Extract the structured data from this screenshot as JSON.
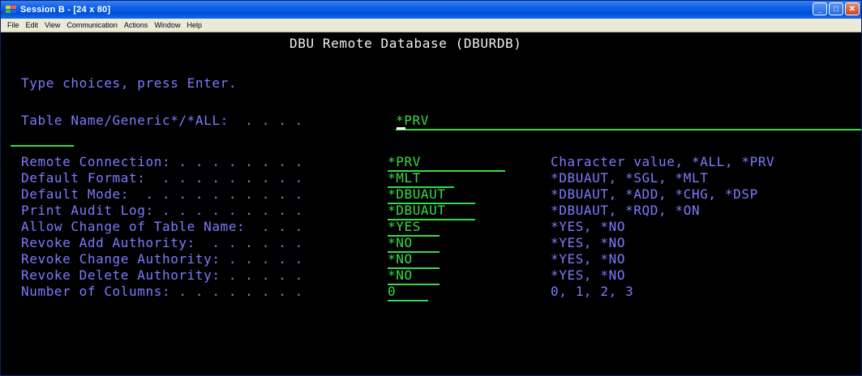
{
  "window": {
    "title": "Session B - [24 x 80]"
  },
  "menu": [
    "File",
    "Edit",
    "View",
    "Communication",
    "Actions",
    "Window",
    "Help"
  ],
  "screen": {
    "heading": "DBU Remote Database (DBURDB)",
    "instructions": "Type choices, press Enter.",
    "table_name": {
      "label": "Table Name/Generic*/*ALL:  . . . .",
      "value": "*PRV"
    },
    "rows": [
      {
        "label": "Remote Connection: . . . . . . . .",
        "value": "*PRV",
        "choices": "Character value, *ALL, *PRV"
      },
      {
        "label": "Default Format:  . . . . . . . . .",
        "value": "*MLT",
        "choices": "*DBUAUT, *SGL, *MLT"
      },
      {
        "label": "Default Mode:  . . . . . . . . . .",
        "value": "*DBUAUT",
        "choices": "*DBUAUT, *ADD, *CHG, *DSP"
      },
      {
        "label": "Print Audit Log: . . . . . . . . .",
        "value": "*DBUAUT",
        "choices": "*DBUAUT, *RQD, *ON"
      },
      {
        "label": "Allow Change of Table Name:  . . .",
        "value": "*YES",
        "choices": "*YES, *NO"
      },
      {
        "label": "Revoke Add Authority:  . . . . . .",
        "value": "*NO",
        "choices": "*YES, *NO"
      },
      {
        "label": "Revoke Change Authority: . . . . .",
        "value": "*NO",
        "choices": "*YES, *NO"
      },
      {
        "label": "Revoke Delete Authority: . . . . .",
        "value": "*NO",
        "choices": "*YES, *NO"
      },
      {
        "label": "Number of Columns: . . . . . . . .",
        "value": "0",
        "choices": "0, 1, 2, 3"
      }
    ]
  },
  "colors": {
    "screen_bg": "#000000",
    "field_text": "#39d94a",
    "info_text": "#7b7bff",
    "heading_text": "#f0f0f0",
    "titlebar": "#0a5fe8"
  },
  "icons": {
    "app": "terminal-session-icon",
    "minimize": "minimize-icon",
    "maximize": "maximize-icon",
    "close": "close-icon"
  }
}
